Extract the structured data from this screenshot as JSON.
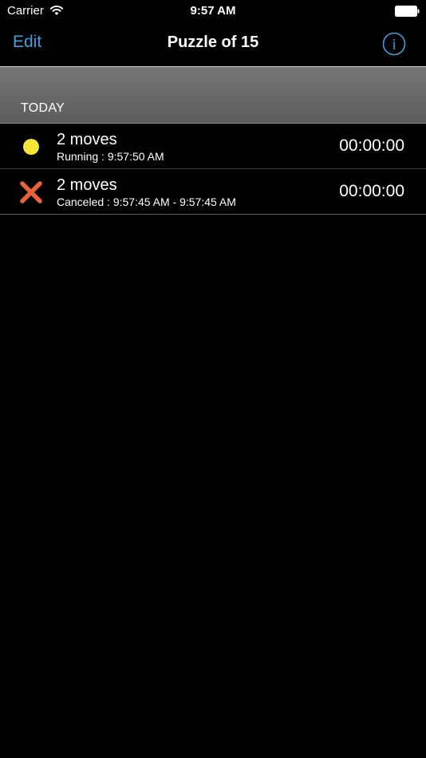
{
  "status_bar": {
    "carrier": "Carrier",
    "time": "9:57 AM"
  },
  "nav": {
    "edit_label": "Edit",
    "title": "Puzzle of 15",
    "info_glyph": "i",
    "accent_color": "#3fa0e0"
  },
  "section": {
    "title": "TODAY"
  },
  "rows": [
    {
      "icon": "running-dot-icon",
      "title": "2 moves",
      "subtitle": "Running : 9:57:50 AM",
      "time": "00:00:00",
      "icon_color": "#f5e63a"
    },
    {
      "icon": "canceled-x-icon",
      "title": "2 moves",
      "subtitle": "Canceled : 9:57:45 AM - 9:57:45 AM",
      "time": "00:00:00",
      "icon_color": "#e8633a"
    }
  ]
}
